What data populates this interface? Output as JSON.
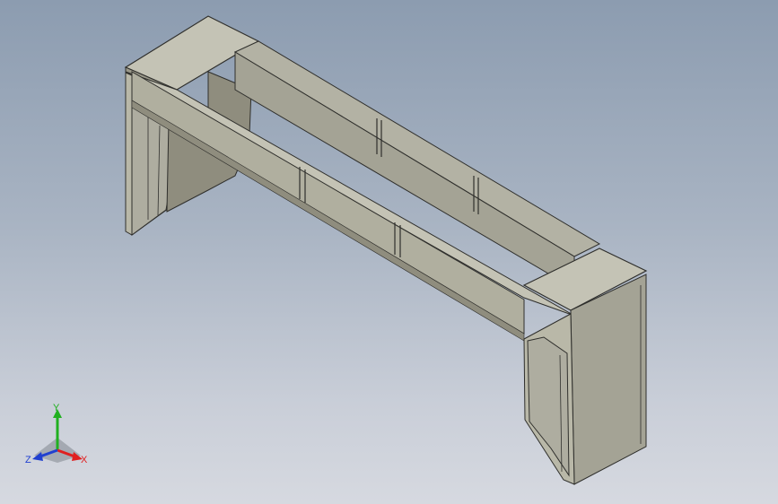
{
  "viewport": {
    "background_top": "#8c9cb0",
    "background_bottom": "#d6d9e0"
  },
  "model": {
    "type": "isometric sheet-metal frame assembly",
    "panel_color": "#b9b8a8",
    "panel_shadow_color": "#8f8d7e",
    "panel_dark_color": "#6f6d62",
    "edge_color": "#2f2f2c"
  },
  "triad": {
    "x_label": "X",
    "y_label": "Y",
    "z_label": "Z",
    "x_color": "#e02020",
    "y_color": "#20b020",
    "z_color": "#2040d0"
  }
}
